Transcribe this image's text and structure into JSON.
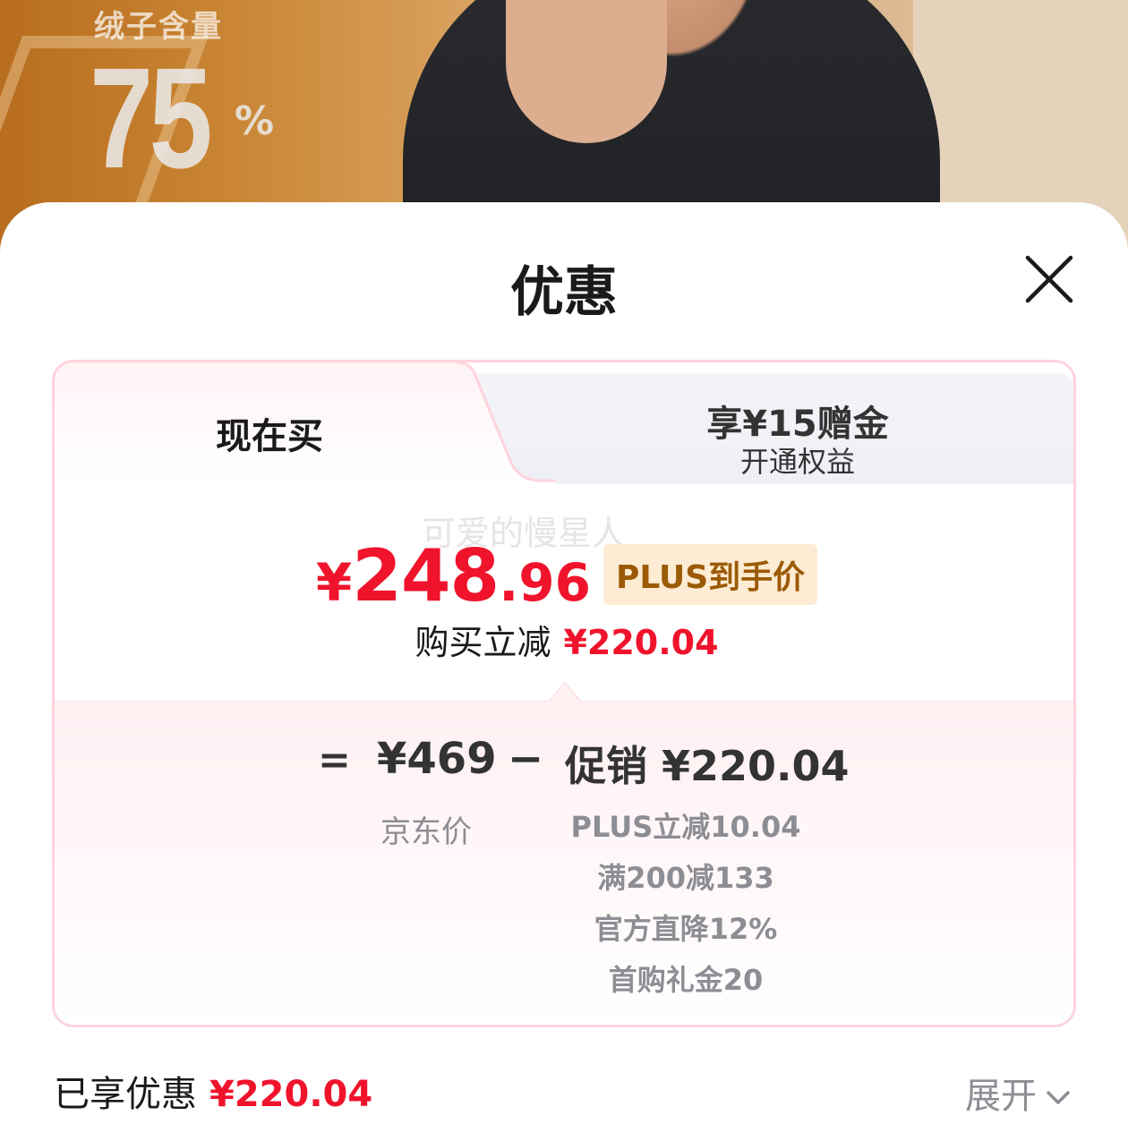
{
  "background": {
    "label_top": "绒子含量",
    "label_value": "75",
    "label_unit": "%"
  },
  "sheet": {
    "title": "优惠",
    "close_icon": "close-icon"
  },
  "tabs": {
    "active_label": "现在买",
    "inactive_title": "享¥15赠金",
    "inactive_subtitle": "开通权益"
  },
  "watermark": "可爱的慢星人",
  "price": {
    "currency": "¥",
    "integer": "248",
    "decimal": ".96",
    "badge": "PLUS到手价"
  },
  "discount": {
    "label": "购买立减",
    "amount": "¥220.04"
  },
  "breakdown": {
    "equals": "=",
    "jd_price": "¥469",
    "minus": "−",
    "promo": "促销 ¥220.04",
    "jd_price_label": "京东价",
    "promo_items": [
      "PLUS立减10.04",
      "满200减133",
      "官方直降12%",
      "首购礼金20"
    ]
  },
  "footer": {
    "label": "已享优惠",
    "amount": "¥220.04",
    "expand_label": "展开",
    "expand_icon": "chevron-down-icon"
  },
  "colors": {
    "accent_red": "#f0132c",
    "badge_bg": "#fdebd3",
    "badge_text": "#9b5a05",
    "card_border": "#ffd3dc"
  }
}
